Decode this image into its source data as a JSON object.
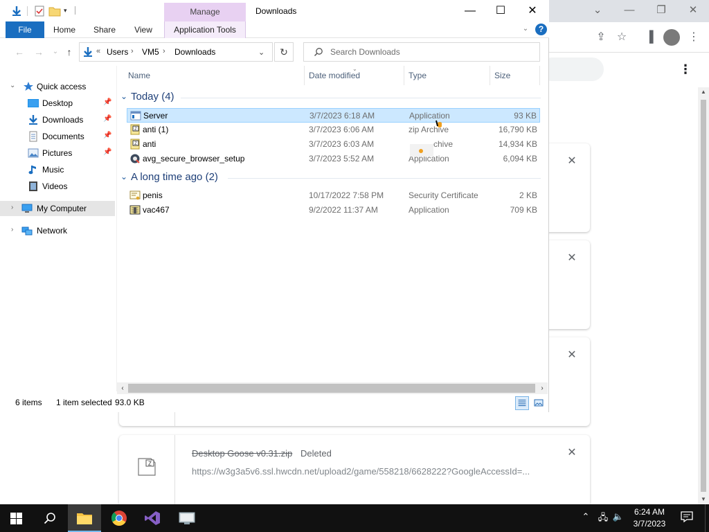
{
  "chrome": {
    "downloads": [
      {
        "filename": "Desktop Goose v0.31.zip",
        "status": "Deleted",
        "url": "https://w3g3a5v6.ssl.hwcdn.net/upload2/game/558218/6628222?GoogleAccessId=..."
      }
    ]
  },
  "explorer": {
    "title": "Downloads",
    "manage_label": "Manage",
    "ribbon_tabs": [
      "File",
      "Home",
      "Share",
      "View",
      "Application Tools"
    ],
    "breadcrumb": [
      "Users",
      "VM5",
      "Downloads"
    ],
    "breadcrumb_overflow": "«",
    "search_placeholder": "Search Downloads",
    "nav": {
      "quick_access": "Quick access",
      "items": [
        {
          "label": "Desktop",
          "icon": "desktop-icon"
        },
        {
          "label": "Downloads",
          "icon": "downloads-icon"
        },
        {
          "label": "Documents",
          "icon": "documents-icon"
        },
        {
          "label": "Pictures",
          "icon": "pictures-icon"
        },
        {
          "label": "Music",
          "icon": "music-icon"
        },
        {
          "label": "Videos",
          "icon": "videos-icon"
        }
      ],
      "my_computer": "My Computer",
      "network": "Network"
    },
    "columns": [
      "Name",
      "Date modified",
      "Type",
      "Size"
    ],
    "groups": [
      {
        "title": "Today (4)",
        "files": [
          {
            "name": "Server",
            "date": "3/7/2023 6:18 AM",
            "type": "Application",
            "size": "93 KB",
            "icon": "application-icon"
          },
          {
            "name": "anti (1)",
            "date": "3/7/2023 6:06 AM",
            "type": "zip Archive",
            "size": "16,790 KB",
            "icon": "zip-archive-icon"
          },
          {
            "name": "anti",
            "date": "3/7/2023 6:03 AM",
            "type": "Archive",
            "size": "14,934 KB",
            "icon": "zip-archive-icon"
          },
          {
            "name": "avg_secure_browser_setup",
            "date": "3/7/2023 5:52 AM",
            "type": "Application",
            "size": "6,094 KB",
            "icon": "avg-setup-icon"
          }
        ]
      },
      {
        "title": "A long time ago (2)",
        "files": [
          {
            "name": "penis",
            "date": "10/17/2022 7:58 PM",
            "type": "Security Certificate",
            "size": "2 KB",
            "icon": "certificate-icon"
          },
          {
            "name": "vac467",
            "date": "9/2/2022 11:37 AM",
            "type": "Application",
            "size": "709 KB",
            "icon": "application-icon"
          }
        ]
      }
    ],
    "status": {
      "count": "6 items",
      "selected": "1 item selected",
      "selected_size": "93.0 KB"
    }
  },
  "taskbar": {
    "clock_time": "6:24 AM",
    "clock_date": "3/7/2023"
  },
  "colors": {
    "file_tab": "#1a6ec0",
    "manage_tab": "#e8d1f2",
    "selection": "#cce8ff",
    "taskbar": "#111111"
  }
}
